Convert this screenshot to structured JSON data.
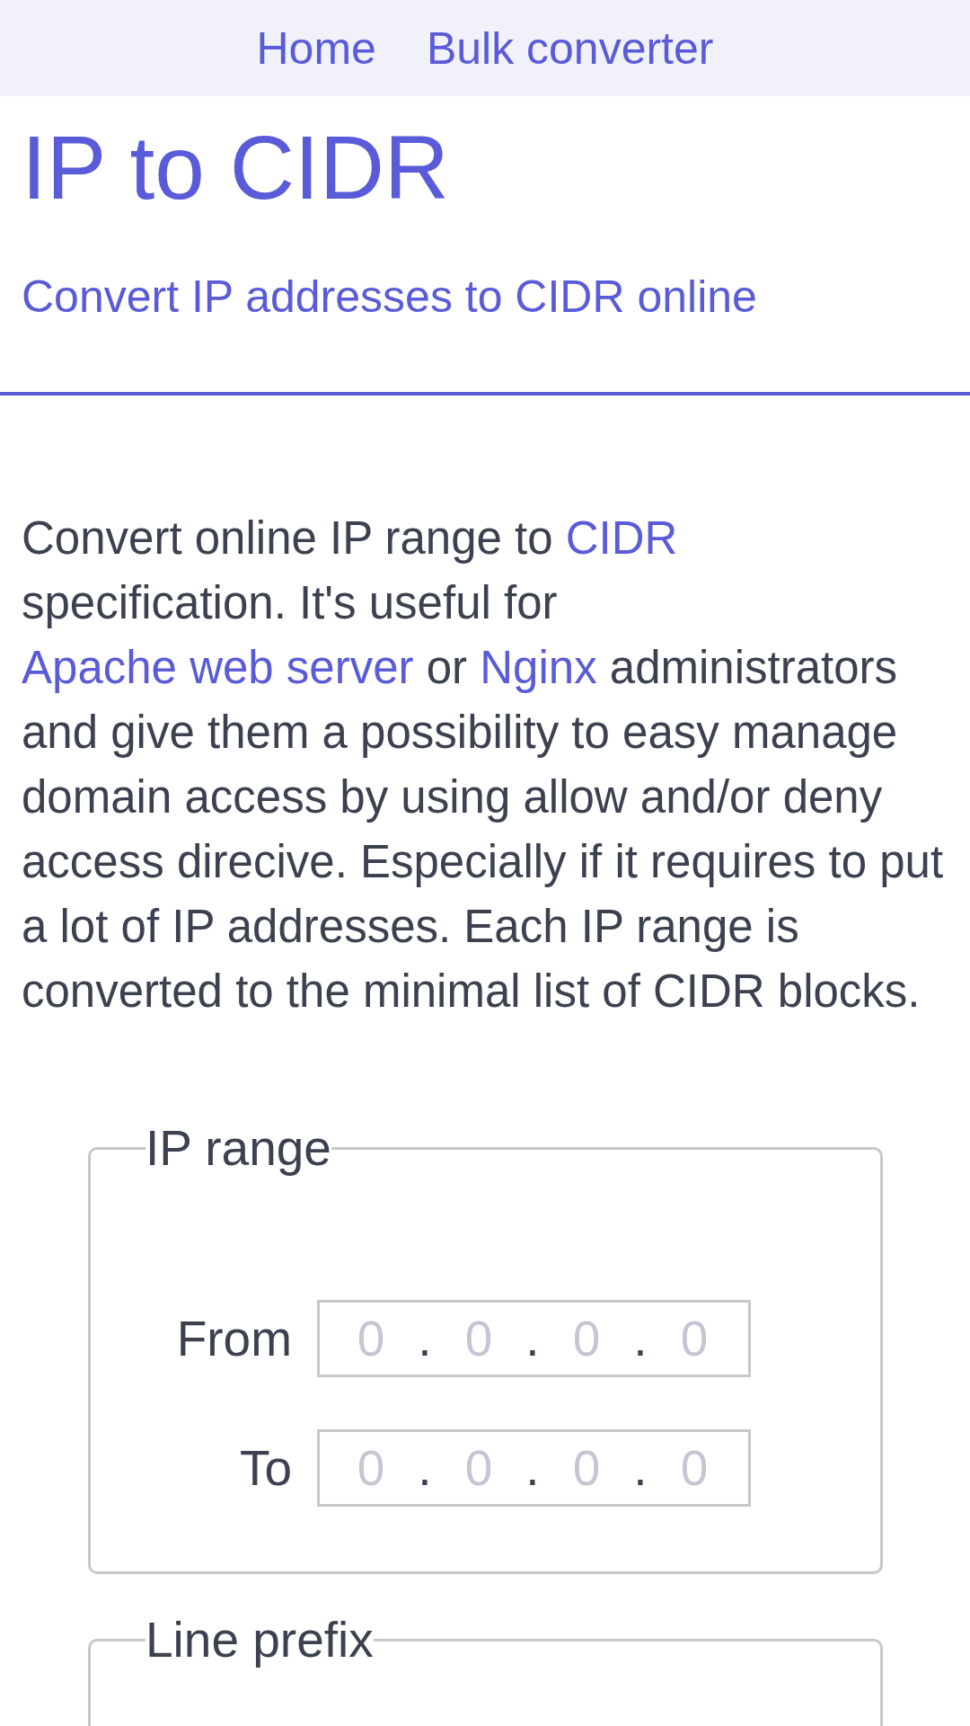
{
  "nav": {
    "links": [
      {
        "label": "Home"
      },
      {
        "label": "Bulk converter"
      }
    ]
  },
  "header": {
    "title": "IP to CIDR",
    "subtitle": "Convert IP addresses to CIDR online"
  },
  "intro": [
    {
      "kind": "text",
      "text": "Convert online IP range to "
    },
    {
      "kind": "link",
      "text": "CIDR"
    },
    {
      "kind": "text",
      "text": " specification. It's useful for "
    },
    {
      "kind": "link",
      "text": "Apache web server"
    },
    {
      "kind": "text",
      "text": " or "
    },
    {
      "kind": "link",
      "text": "Nginx"
    },
    {
      "kind": "text",
      "text": " administrators and give them a possibility to easy manage domain access by using allow and/or deny access direcive. Especially if it requires to put a lot of IP addresses. Each IP range is converted to the minimal list of CIDR blocks."
    }
  ],
  "fieldsets": [
    {
      "legend": "IP range",
      "rows": [
        {
          "label": "From",
          "octets": [
            {
              "placeholder": "0",
              "separator": "."
            },
            {
              "placeholder": "0",
              "separator": "."
            },
            {
              "placeholder": "0",
              "separator": "."
            },
            {
              "placeholder": "0"
            }
          ]
        },
        {
          "label": "To",
          "octets": [
            {
              "placeholder": "0",
              "separator": "."
            },
            {
              "placeholder": "0",
              "separator": "."
            },
            {
              "placeholder": "0",
              "separator": "."
            },
            {
              "placeholder": "0"
            }
          ]
        }
      ]
    },
    {
      "legend": "Line prefix"
    }
  ]
}
